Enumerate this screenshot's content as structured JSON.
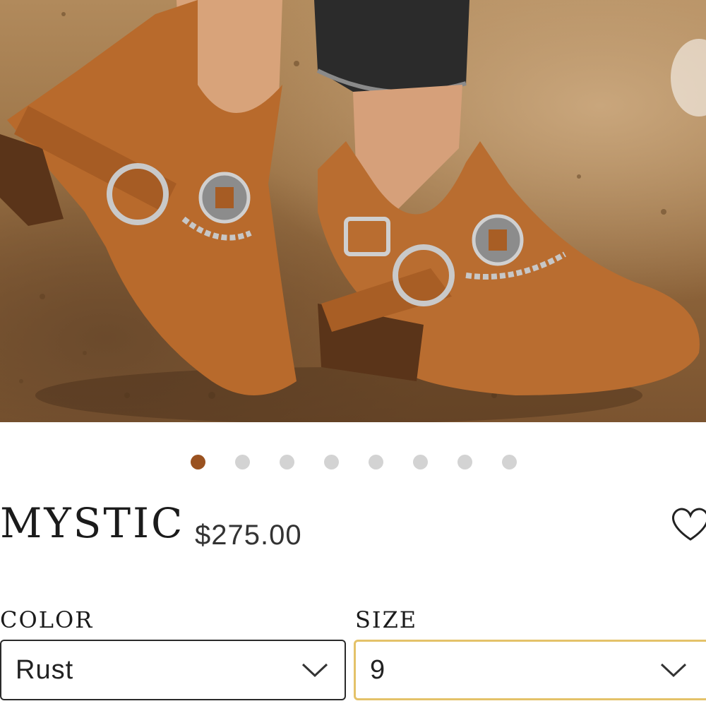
{
  "product": {
    "title": "MYSTIC",
    "price": "$275.00"
  },
  "gallery": {
    "image_count": 8,
    "active_index": 0,
    "active_dot_color": "#9a5220",
    "inactive_dot_color": "#d3d3d3"
  },
  "options": {
    "color": {
      "label": "COLOR",
      "value": "Rust"
    },
    "size": {
      "label": "SIZE",
      "value": "9"
    }
  },
  "icons": {
    "wishlist": "heart-icon",
    "dropdown": "chevron-down-icon",
    "next": "next-arrow-icon"
  },
  "colors": {
    "focus_border": "#e4c269",
    "boot_leather": "#b76a2e"
  }
}
